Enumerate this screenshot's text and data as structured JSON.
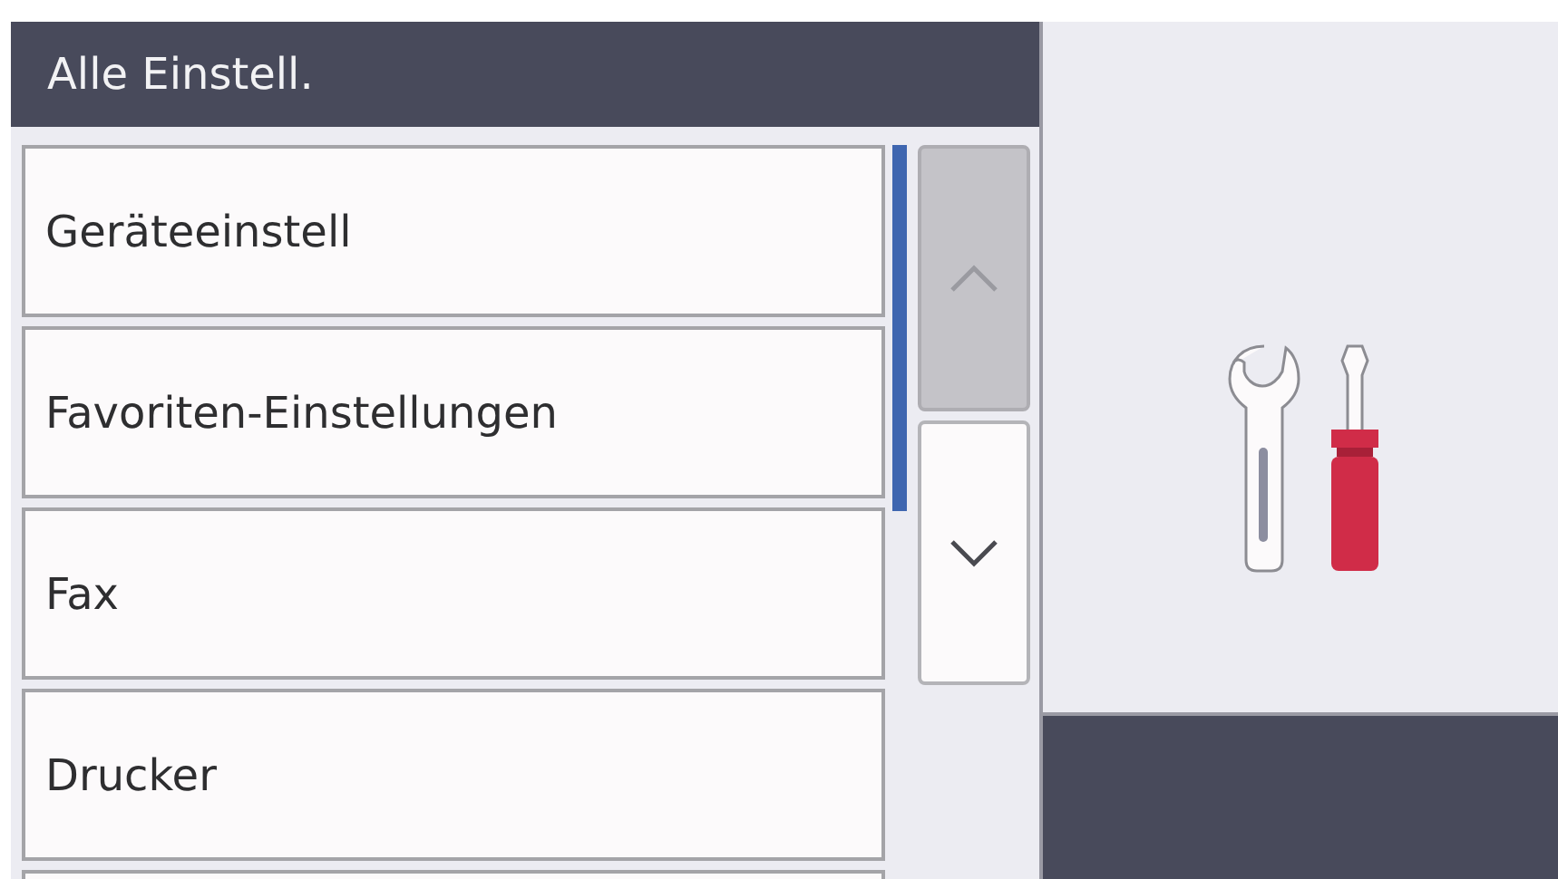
{
  "header": {
    "title": "Alle Einstell."
  },
  "menu_items": [
    {
      "label": "Geräteeinstell"
    },
    {
      "label": "Favoriten-Einstellungen"
    },
    {
      "label": "Fax"
    },
    {
      "label": "Drucker"
    }
  ],
  "scroll_buttons": [
    {
      "kind": "up",
      "disabled": true
    },
    {
      "kind": "down",
      "disabled": false
    }
  ]
}
